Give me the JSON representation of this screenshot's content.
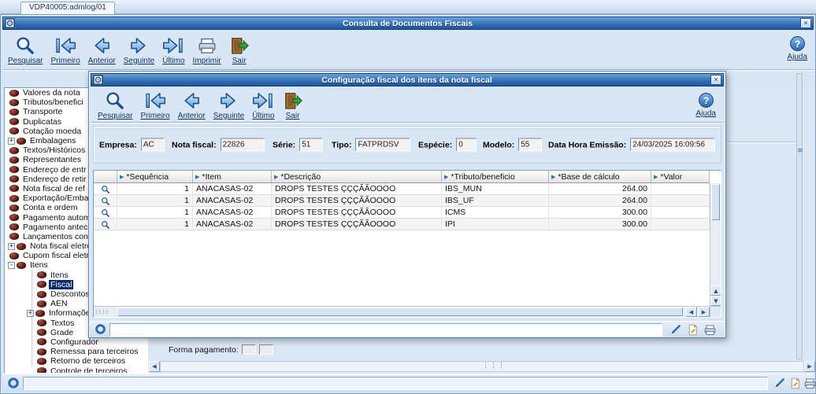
{
  "colors": {
    "titlebar_top": "#6ba3dd",
    "titlebar_bottom": "#1e5499",
    "accent": "#1c4f8c",
    "selection_bg": "#0b2a66",
    "window_bg": "#d9e6f4"
  },
  "tab": {
    "label": "VDP40005:admlog/01"
  },
  "window": {
    "title": "Consulta de Documentos Fiscais"
  },
  "toolbar": {
    "buttons": [
      {
        "label": "Pesquisar",
        "icon": "search-icon"
      },
      {
        "label": "Primeiro",
        "icon": "first-icon"
      },
      {
        "label": "Anterior",
        "icon": "previous-icon"
      },
      {
        "label": "Seguinte",
        "icon": "next-icon"
      },
      {
        "label": "Último",
        "icon": "last-icon"
      },
      {
        "label": "Imprimir",
        "icon": "print-icon"
      },
      {
        "label": "Sair",
        "icon": "exit-icon"
      }
    ],
    "help_label": "Ajuda"
  },
  "tree": {
    "items": [
      {
        "label": "Valores da nota",
        "level": 0
      },
      {
        "label": "Tributos/benefici",
        "level": 0
      },
      {
        "label": "Transporte",
        "level": 0
      },
      {
        "label": "Duplicatas",
        "level": 0
      },
      {
        "label": "Cotação moeda",
        "level": 0
      },
      {
        "label": "Embalagens",
        "level": 0,
        "expander": "+"
      },
      {
        "label": "Textos/Históricos",
        "level": 0
      },
      {
        "label": "Representantes",
        "level": 0
      },
      {
        "label": "Endereço de entr",
        "level": 0
      },
      {
        "label": "Endereço de retir",
        "level": 0
      },
      {
        "label": "Nota fiscal de ref",
        "level": 0
      },
      {
        "label": "Exportação/Emba",
        "level": 0
      },
      {
        "label": "Conta e ordem",
        "level": 0
      },
      {
        "label": "Pagamento autom",
        "level": 0
      },
      {
        "label": "Pagamento antec",
        "level": 0
      },
      {
        "label": "Lançamentos con",
        "level": 0
      },
      {
        "label": "Nota fiscal eletrô",
        "level": 0,
        "expander": "+"
      },
      {
        "label": "Cupom fiscal eletr",
        "level": 0
      },
      {
        "label": "Itens",
        "level": 0,
        "expander": "-"
      },
      {
        "label": "Itens",
        "level": 1
      },
      {
        "label": "Fiscal",
        "level": 1,
        "selected": true
      },
      {
        "label": "Descontos/A",
        "level": 1
      },
      {
        "label": "AEN",
        "level": 1
      },
      {
        "label": "Informações",
        "level": 1,
        "expander": "+"
      },
      {
        "label": "Textos",
        "level": 1
      },
      {
        "label": "Grade",
        "level": 1
      },
      {
        "label": "Configurador",
        "level": 1
      },
      {
        "label": "Remessa para terceiros",
        "level": 1
      },
      {
        "label": "Retorno de terceiros",
        "level": 1
      },
      {
        "label": "Controle de terceiros",
        "level": 1
      }
    ]
  },
  "modal": {
    "title": "Configuração fiscal dos itens da nota fiscal",
    "toolbar": {
      "buttons": [
        {
          "label": "Pesquisar",
          "icon": "search-icon"
        },
        {
          "label": "Primeiro",
          "icon": "first-icon"
        },
        {
          "label": "Anterior",
          "icon": "previous-icon"
        },
        {
          "label": "Seguinte",
          "icon": "next-icon"
        },
        {
          "label": "Último",
          "icon": "last-icon"
        },
        {
          "label": "Sair",
          "icon": "exit-icon"
        }
      ],
      "help_label": "Ajuda"
    },
    "form": {
      "fields": [
        {
          "label": "Empresa:",
          "value": "AC"
        },
        {
          "label": "Nota fiscal:",
          "value": "22826"
        },
        {
          "label": "Série:",
          "value": "51"
        },
        {
          "label": "Tipo:",
          "value": "FATPRDSV"
        },
        {
          "label": "Espécie:",
          "value": "0"
        },
        {
          "label": "Modelo:",
          "value": "55"
        },
        {
          "label": "Data Hora Emissão:",
          "value": "24/03/2025 16:09:56"
        }
      ]
    },
    "table": {
      "columns": [
        "*Sequência",
        "*Item",
        "*Descrição",
        "*Tributo/beneficio",
        "*Base de cálculo",
        "*Valor"
      ],
      "rows": [
        [
          "1",
          "ANACASAS-02",
          "DROPS TESTES ÇÇÇÃÃOOOO",
          "IBS_MUN",
          "264.00",
          ""
        ],
        [
          "1",
          "ANACASAS-02",
          "DROPS TESTES ÇÇÇÃÃOOOO",
          "IBS_UF",
          "264.00",
          ""
        ],
        [
          "1",
          "ANACASAS-02",
          "DROPS TESTES ÇÇÇÃÃOOOO",
          "ICMS",
          "300.00",
          ""
        ],
        [
          "1",
          "ANACASAS-02",
          "DROPS TESTES ÇÇÇÃÃOOOO",
          "IPI",
          "300.00",
          ""
        ]
      ]
    }
  },
  "main": {
    "forma_pagamento_label": "Forma pagamento:"
  },
  "icons": {
    "search-icon": "magnifier",
    "first-icon": "arrow-left-with-bar",
    "previous-icon": "arrow-left",
    "next-icon": "arrow-right",
    "last-icon": "arrow-right-with-bar",
    "print-icon": "printer",
    "exit-icon": "door-with-green-arrow",
    "help-icon": "blue-circle-question-mark"
  }
}
